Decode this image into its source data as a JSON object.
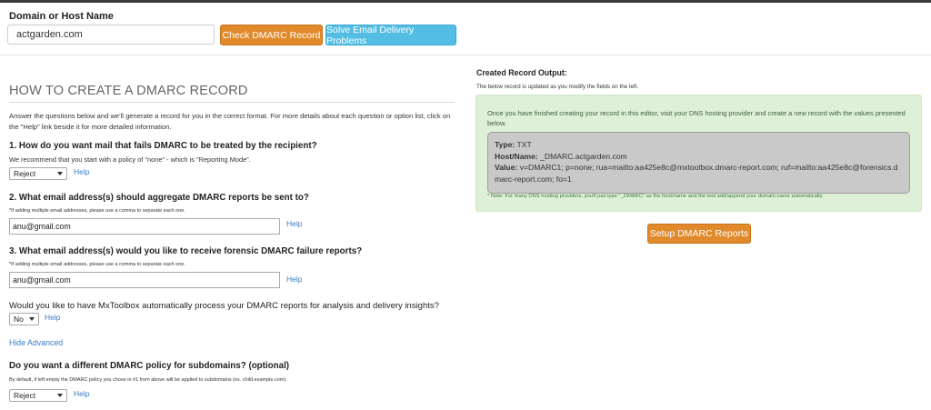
{
  "header": {
    "domain_label": "Domain or Host Name",
    "domain_value": "actgarden.com",
    "check_button": "Check DMARC Record",
    "solve_button": "Solve Email Delivery Problems"
  },
  "form": {
    "title": "HOW TO CREATE A DMARC RECORD",
    "intro": "Answer the questions below and we'll generate a record for you in the correct format. For more details about each question or option list, click on the \"Help\" link beside it for more detailed information.",
    "help_label": "Help",
    "q1": {
      "title": "1. How do you want mail that fails DMARC to be treated by the recipient?",
      "note": "We recommend that you start with a policy of \"none\" - which is \"Reporting Mode\".",
      "selected": "Reject"
    },
    "q2": {
      "title": "2. What email address(s) should aggregate DMARC reports be sent to?",
      "note": "*If adding multiple email addresses, please use a comma to separate each one.",
      "value": "anu@gmail.com"
    },
    "q3": {
      "title": "3. What email address(s) would you like to receive forensic DMARC failure reports?",
      "note": "*If adding multiple email addresses, please use a comma to separate each one.",
      "value": "anu@gmail.com"
    },
    "q4": {
      "title": "Would you like to have MxToolbox automatically process your DMARC reports for analysis and delivery insights?",
      "selected": "No"
    },
    "hide_advanced": "Hide Advanced",
    "q5": {
      "title": "Do you want a different DMARC policy for subdomains? (optional)",
      "note": "By default, if left empty the DMARC policy you chose in #1 from above will be applied to subdomains (ex. child.example.com).",
      "selected": "Reject"
    }
  },
  "output": {
    "title": "Created Record Output:",
    "subtitle": "The below record is updated as you modify the fields on the left.",
    "instructions": "Once you have finished creating your record in this editor, visit your DNS hosting provider and create a new record with the values presented below.",
    "type_label": "Type:",
    "type_value": "TXT",
    "host_label": "Host/Name:",
    "host_value": "_DMARC.actgarden.com",
    "value_label": "Value:",
    "value_value": "v=DMARC1; p=none; rua=mailto:aa425e8c@mxtoolbox.dmarc-report.com; ruf=mailto:aa425e8c@forensics.dmarc-report.com; fo=1",
    "note": "* Note: For many DNS hosting providers, you'll just type \"_DMARC\" as the host/name and the tool add/append your domain name automatically.",
    "setup_button": "Setup DMARC Reports"
  },
  "colors": {
    "orange": "#e08a2c",
    "blue": "#53bde3",
    "green_bg": "#dff0d8",
    "link": "#3b7fc4"
  }
}
